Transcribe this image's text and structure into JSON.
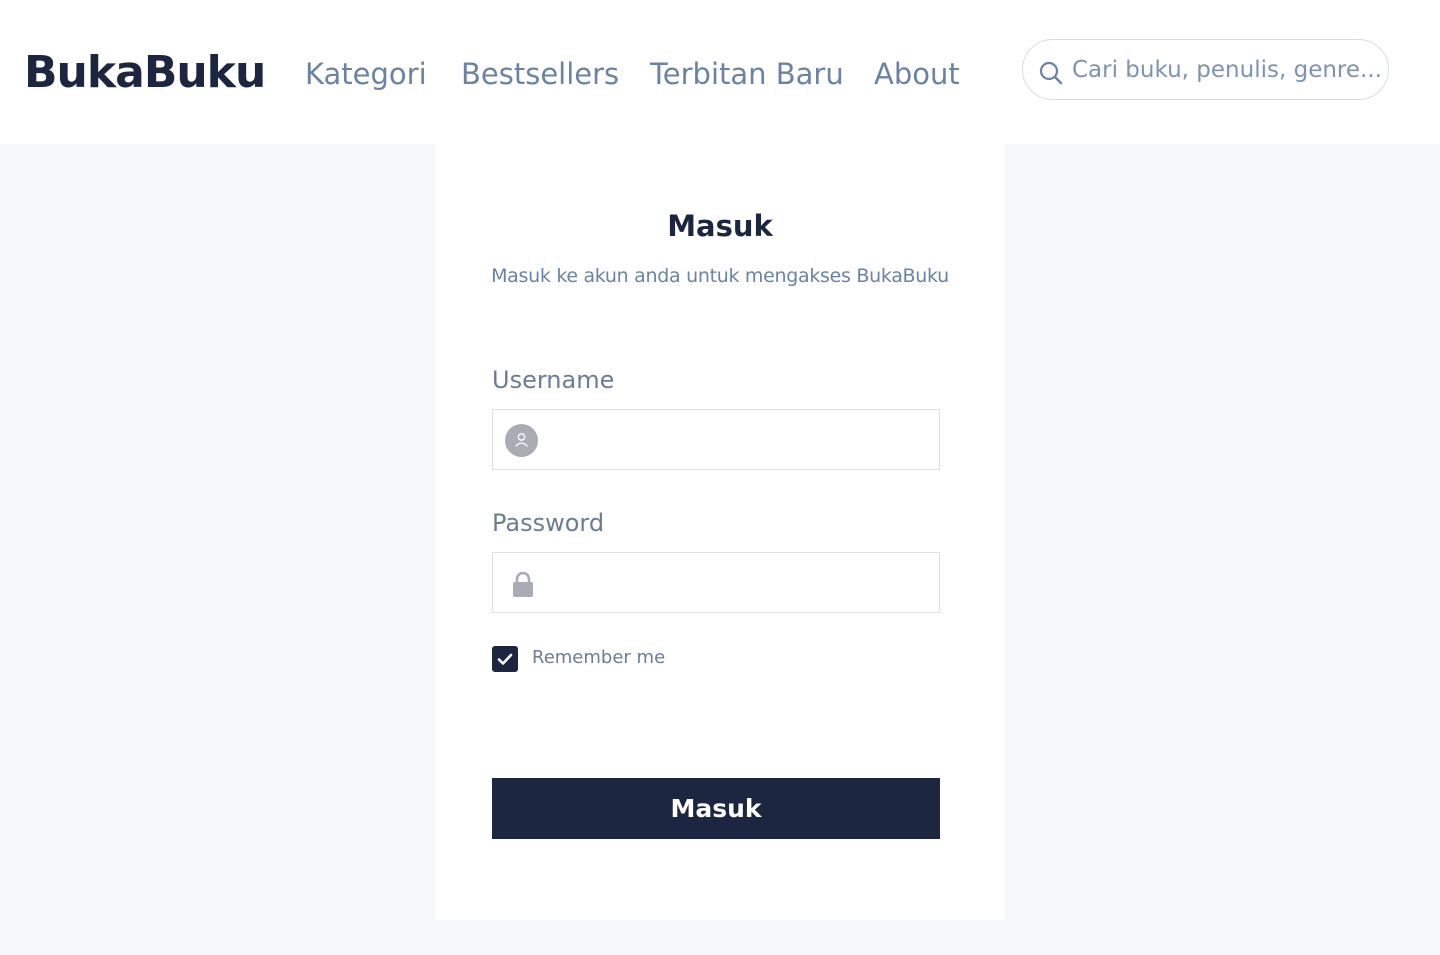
{
  "brand": "BukaBuku",
  "nav": {
    "items": [
      {
        "label": "Kategori"
      },
      {
        "label": "Bestsellers"
      },
      {
        "label": "Terbitan Baru"
      },
      {
        "label": "About"
      }
    ]
  },
  "search": {
    "placeholder": "Cari buku, penulis, genre...",
    "icon": "search-icon"
  },
  "login": {
    "title": "Masuk",
    "subtitle": "Masuk ke akun anda untuk mengakses BukaBuku",
    "username": {
      "label": "Username",
      "value": "",
      "icon": "user-icon"
    },
    "password": {
      "label": "Password",
      "value": "",
      "icon": "lock-icon"
    },
    "remember": {
      "label": "Remember me",
      "checked": true
    },
    "submit_label": "Masuk"
  },
  "colors": {
    "primary": "#1c2640",
    "link": "#6b83a3",
    "background": "#f7f8fa",
    "icon_gray": "#a9acb5"
  }
}
